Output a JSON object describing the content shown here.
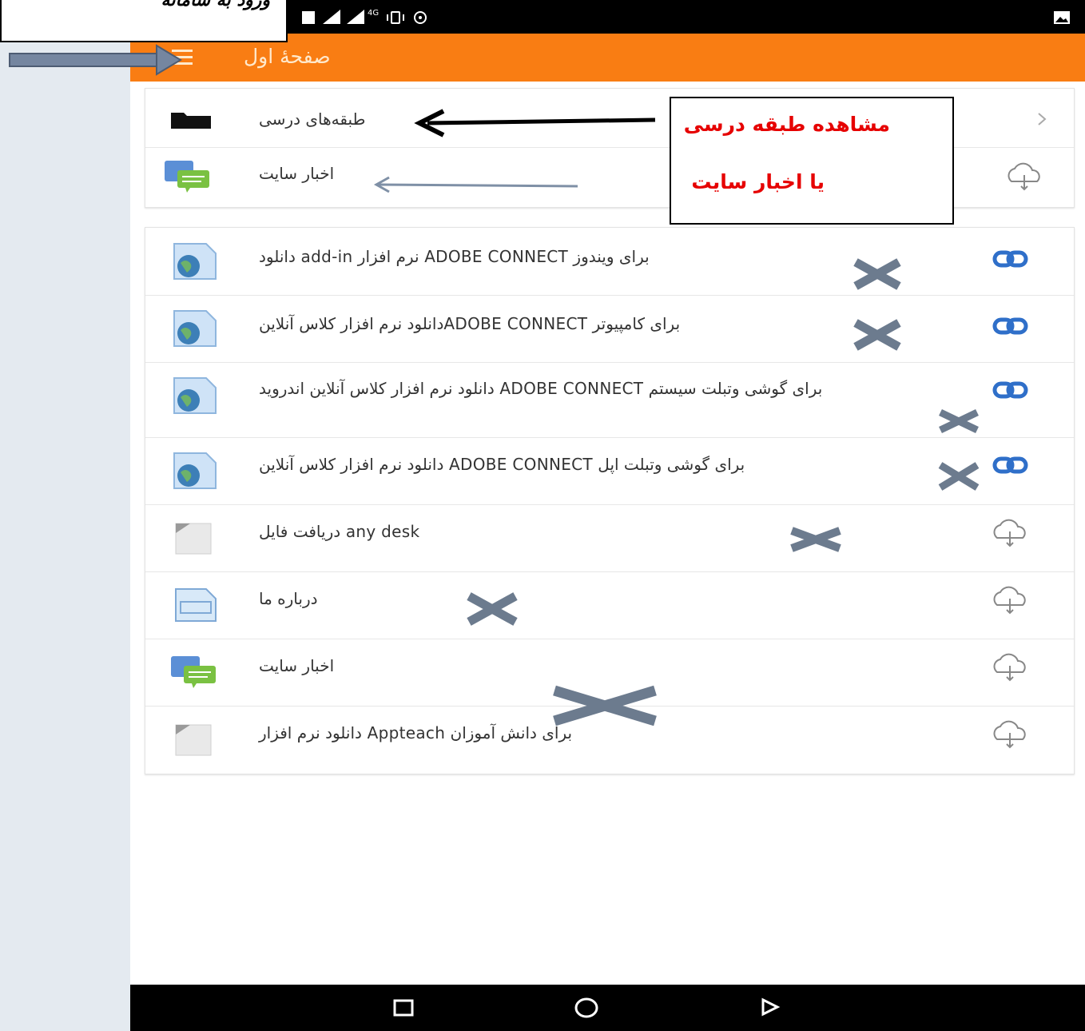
{
  "app": {
    "title": "صفحهٔ اول"
  },
  "statusbar": {
    "network": "4G"
  },
  "section1": [
    {
      "label": "طبقه‌های درسی",
      "icon": "folder-icon",
      "action_icon": "chevron-right-icon"
    },
    {
      "label": "اخبار سایت",
      "icon": "forum-icon",
      "action_icon": "cloud-download-icon"
    }
  ],
  "section2": [
    {
      "label": "برای ویندوز ADOBE CONNECT نرم افزار add-in دانلود",
      "icon": "url-globe-icon",
      "action_icon": "link-icon"
    },
    {
      "label": "برای کامپیوتر ADOBE CONNECTدانلود نرم افزار کلاس آنلاین",
      "icon": "url-globe-icon",
      "action_icon": "link-icon"
    },
    {
      "label": "برای گوشی وتبلت سیستم ADOBE CONNECT دانلود نرم افزار کلاس آنلاین اندروید",
      "icon": "url-globe-icon",
      "action_icon": "link-icon"
    },
    {
      "label": "برای گوشی وتبلت اپل ADOBE CONNECT دانلود نرم افزار کلاس آنلاین",
      "icon": "url-globe-icon",
      "action_icon": "link-icon"
    },
    {
      "label": "any desk دریافت فایل",
      "icon": "file-icon",
      "action_icon": "cloud-download-icon"
    },
    {
      "label": "درباره ما",
      "icon": "page-icon",
      "action_icon": "cloud-download-icon"
    },
    {
      "label": "اخبار سایت",
      "icon": "forum-icon",
      "action_icon": "cloud-download-icon"
    },
    {
      "label": "برای دانش آموزان Appteach دانلود نرم افزار",
      "icon": "file-icon",
      "action_icon": "cloud-download-icon"
    }
  ],
  "annotations": {
    "callout_line1": "مشاهده طبقه درسی",
    "callout_line2": "یا اخبار سایت",
    "top_label": "ورود به سامانه"
  },
  "colors": {
    "appbar": "#f97d13",
    "link": "#2f6fc9",
    "callout_text": "#e60000",
    "arrow": "#6f7f93"
  }
}
